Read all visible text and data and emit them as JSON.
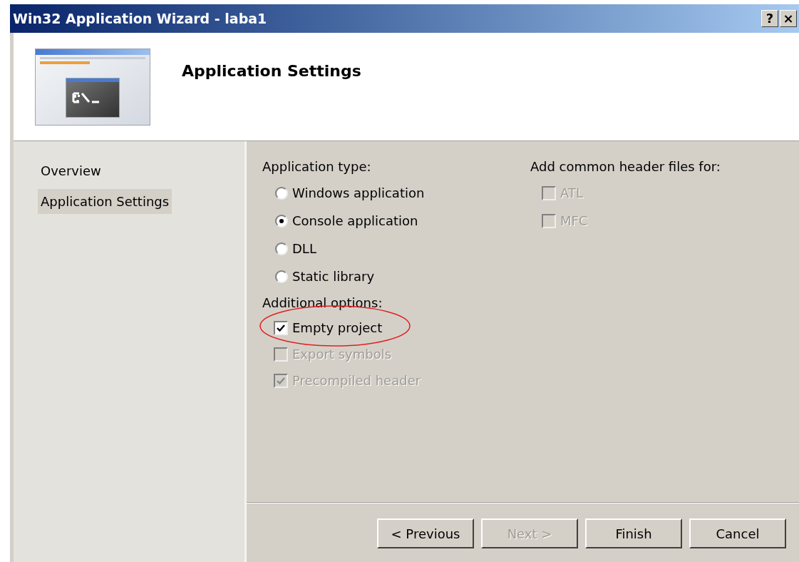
{
  "window": {
    "title": "Win32 Application Wizard - laba1",
    "controls": [
      "?",
      "×"
    ]
  },
  "header": {
    "title": "Application Settings"
  },
  "sidebar": {
    "items": [
      {
        "label": "Overview",
        "selected": false
      },
      {
        "label": "Application Settings",
        "selected": true
      }
    ]
  },
  "application_type": {
    "label": "Application type:",
    "options": [
      {
        "label": "Windows application",
        "selected": false
      },
      {
        "label": "Console application",
        "selected": true
      },
      {
        "label": "DLL",
        "selected": false
      },
      {
        "label": "Static library",
        "selected": false
      }
    ]
  },
  "additional_options": {
    "label": "Additional options:",
    "options": [
      {
        "label": "Empty project",
        "checked": true,
        "disabled": false,
        "highlighted": true
      },
      {
        "label": "Export symbols",
        "checked": false,
        "disabled": true,
        "highlighted": false
      },
      {
        "label": "Precompiled header",
        "checked": true,
        "disabled": true,
        "highlighted": false
      }
    ]
  },
  "common_headers": {
    "label": "Add common header files for:",
    "options": [
      {
        "label": "ATL",
        "checked": false,
        "disabled": true
      },
      {
        "label": "MFC",
        "checked": false,
        "disabled": true
      }
    ]
  },
  "buttons": [
    {
      "label": "< Previous",
      "disabled": false
    },
    {
      "label": "Next >",
      "disabled": true
    },
    {
      "label": "Finish",
      "disabled": false
    },
    {
      "label": "Cancel",
      "disabled": false
    }
  ]
}
